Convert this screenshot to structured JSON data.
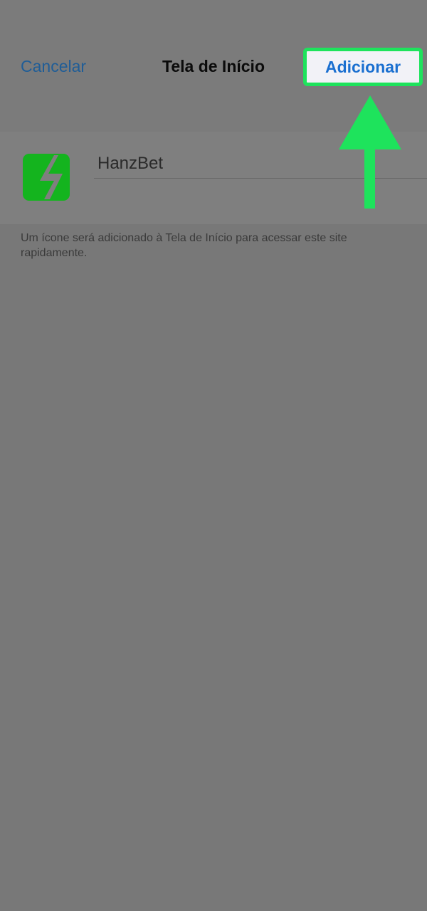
{
  "navbar": {
    "cancel_label": "Cancelar",
    "title": "Tela de Início",
    "add_label": "Adicionar"
  },
  "form": {
    "app_icon": "lightning-bolt-icon",
    "name_value": "HanzBet",
    "description": "Um ícone será adicionado à Tela de Início para acessar este site rapidamente."
  },
  "annotation": {
    "arrow_icon": "arrow-up-icon",
    "highlight_color": "#1ee35c"
  },
  "colors": {
    "background": "#787878",
    "link": "#1a6fd0",
    "icon_green": "#14b41e"
  }
}
